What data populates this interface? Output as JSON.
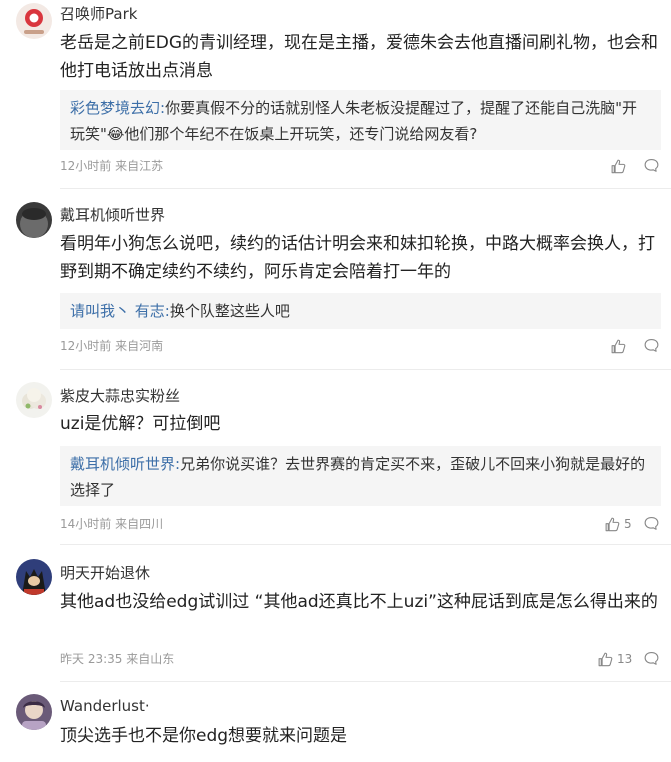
{
  "comments": [
    {
      "username": "召唤师Park",
      "content": "老岳是之前EDG的青训经理，现在是主播，爱德朱会去他直播间刷礼物，也会和他打电话放出点消息",
      "reply_user": "彩色梦境去幻:",
      "reply_text": "你要真假不分的话就别怪人朱老板没提醒过了，提醒了还能自己洗脑\"开玩笑\"😂他们那个年纪不在饭桌上开玩笑，还专门说给网友看?",
      "time": "12小时前",
      "location": "来自江苏",
      "likes": ""
    },
    {
      "username": "戴耳机倾听世界",
      "content": "看明年小狗怎么说吧，续约的话估计明会来和妹扣轮换，中路大概率会换人，打野到期不确定续约不续约，阿乐肯定会陪着打一年的",
      "reply_user": "请叫我丶 有志:",
      "reply_text": "换个队整这些人吧",
      "time": "12小时前",
      "location": "来自河南",
      "likes": ""
    },
    {
      "username": "紫皮大蒜忠实粉丝",
      "content": "uzi是优解？可拉倒吧",
      "reply_user": "戴耳机倾听世界:",
      "reply_text": "兄弟你说买谁？去世界赛的肯定买不来，歪破儿不回来小狗就是最好的选择了",
      "time": "14小时前",
      "location": "来自四川",
      "likes": "5"
    },
    {
      "username": "明天开始退休",
      "content": "其他ad也没给edg试训过 “其他ad还真比不上uzi”这种屁话到底是怎么得出来的",
      "time": "昨天 23:35",
      "location": "来自山东",
      "likes": "13"
    },
    {
      "username": "Wanderlust·",
      "content": "顶尖选手也不是你edg想要就来问题是"
    }
  ],
  "icons": {
    "like": "thumb-up-icon",
    "reply": "speech-bubble-icon"
  },
  "colors": {
    "reply_user": "#3d6fa8",
    "reply_bg": "#f5f5f5",
    "meta": "#9a9a9a"
  }
}
